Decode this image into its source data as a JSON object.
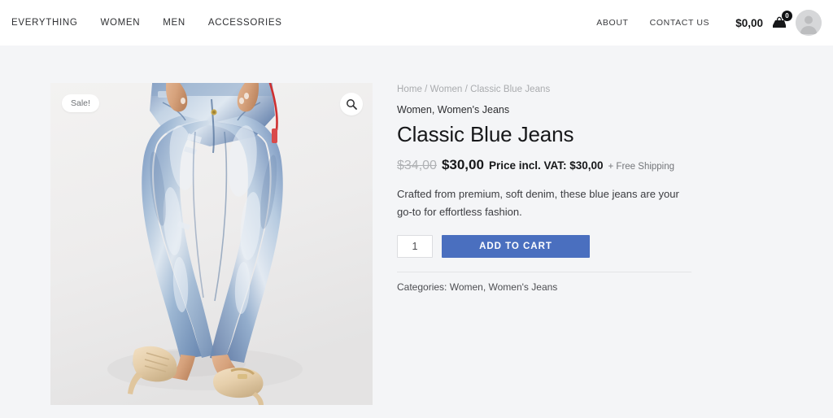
{
  "header": {
    "nav_left": [
      {
        "label": "EVERYTHING"
      },
      {
        "label": "WOMEN"
      },
      {
        "label": "MEN"
      },
      {
        "label": "ACCESSORIES"
      }
    ],
    "nav_right": [
      {
        "label": "ABOUT"
      },
      {
        "label": "CONTACT US"
      }
    ],
    "cart_total": "$0,00",
    "cart_count": "0",
    "cart_icon": "shopping-cart-icon",
    "avatar_icon": "user-avatar-icon"
  },
  "product": {
    "breadcrumb": "Home / Women / Classic Blue Jeans",
    "categories_inline": "Women, Women's Jeans",
    "title": "Classic Blue Jeans",
    "price_old": "$34,00",
    "price_new": "$30,00",
    "price_vat": "Price incl. VAT: $30,00",
    "price_shipping": "+ Free Shipping",
    "description": "Crafted from premium, soft denim, these blue jeans are your go-to for effortless fashion.",
    "quantity_value": "1",
    "add_to_cart_label": "ADD TO CART",
    "categories_label": "Categories:",
    "categories_value": "Women, Women's Jeans",
    "sale_badge": "Sale!",
    "zoom_icon": "search-magnifier-icon",
    "image_alt": "Model wearing light wash blue skinny jeans with nude high heels"
  },
  "colors": {
    "accent_blue": "#4a6fbf",
    "page_background": "#f4f5f7",
    "header_background": "#ffffff",
    "text_dark": "#17181a",
    "text_muted": "#a9abae"
  }
}
